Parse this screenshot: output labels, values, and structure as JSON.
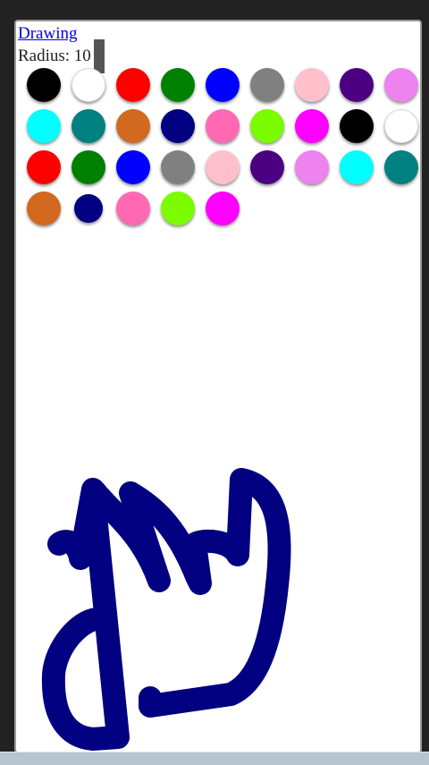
{
  "header": {
    "title_link": "Drawing",
    "radius_label": "Radius: 10"
  },
  "palette": [
    "#000000",
    "#ffffff",
    "#ff0000",
    "#008000",
    "#0000ff",
    "#808080",
    "#ffc0cb",
    "#4b0082",
    "#ee82ee",
    "#00ffff",
    "#008080",
    "#d2691e",
    "#000080",
    "#ff69b4",
    "#7cfc00",
    "#ff00ff",
    "#000000",
    "#ffffff",
    "#ff0000",
    "#008000",
    "#0000ff",
    "#808080",
    "#ffc0cb",
    "#4b0082",
    "#ee82ee",
    "#00ffff",
    "#008080",
    "#d2691e",
    "#000080",
    "#ff69b4",
    "#7cfc00",
    "#ff00ff"
  ],
  "stroke": {
    "color": "#000080"
  }
}
